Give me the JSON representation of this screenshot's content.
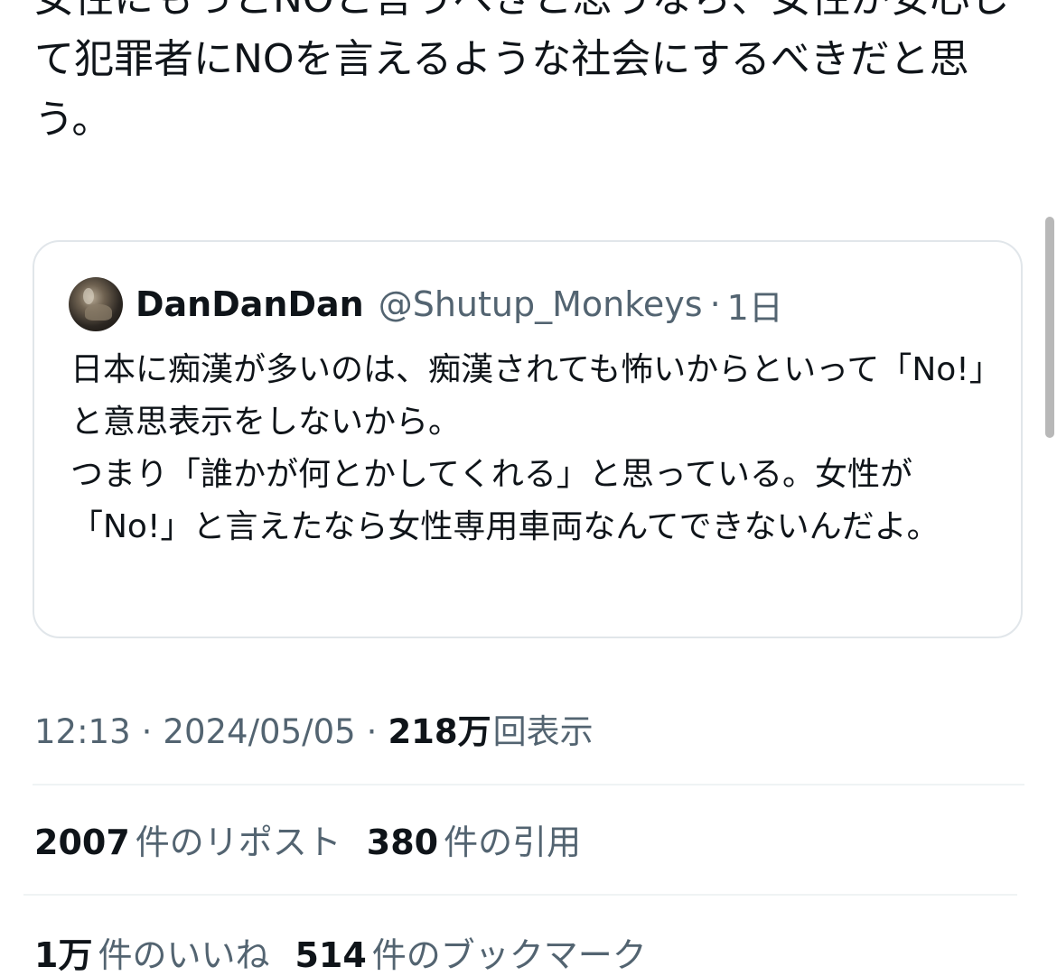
{
  "post": {
    "text": "女性にもっとNOと言うべきと思うなら、女性が安心して犯罪者にNOを言えるような社会にするべきだと思う。"
  },
  "quote": {
    "display_name": "DanDanDan",
    "handle": "@Shutup_Monkeys",
    "separator": "·",
    "relative_time": "1日",
    "text": "日本に痴漢が多いのは、痴漢されても怖いからといって「No!」と意思表示をしないから。\nつまり「誰かが何とかしてくれる」と思っている。女性が「No!」と言えたなら女性専用車両なんてできないんだよ。"
  },
  "meta": {
    "time": "12:13",
    "separator": "·",
    "date": "2024/05/05",
    "views_count": "218万",
    "views_label": "回表示"
  },
  "stats": {
    "reposts_count": "2007",
    "reposts_label": "件のリポスト",
    "quotes_count": "380",
    "quotes_label": "件の引用",
    "likes_count": "1万",
    "likes_label": "件のいいね",
    "bookmarks_count": "514",
    "bookmarks_label": "件のブックマーク"
  },
  "colors": {
    "text_primary": "#0f1419",
    "text_secondary": "#536471",
    "border": "#e1e6ea",
    "divider": "#eff3f4",
    "scrollbar": "#b8b8b8"
  }
}
